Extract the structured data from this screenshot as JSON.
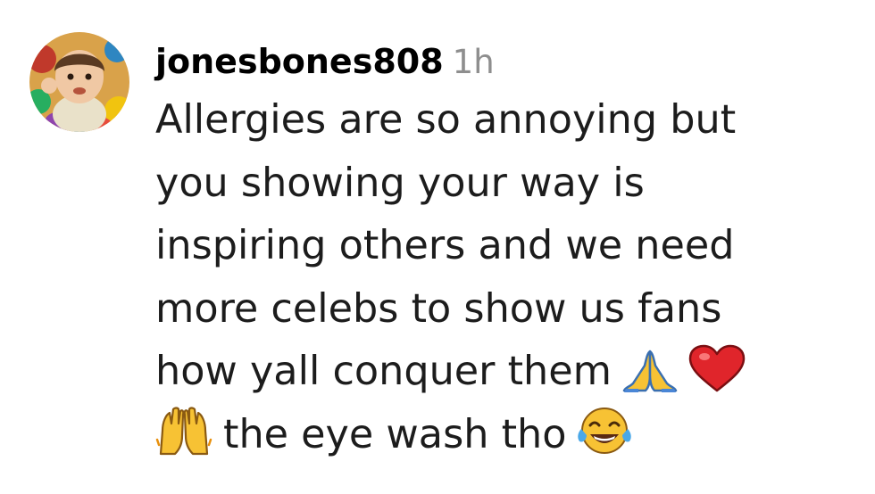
{
  "comment": {
    "username": "jonesbones808",
    "timestamp": "1h",
    "lines": [
      "Allergies are so annoying but",
      "you showing your way is",
      "inspiring others and we need",
      "more celebs to show us fans",
      "how yall conquer them",
      "the eye wash tho"
    ],
    "emojis": {
      "line5": [
        "folded-hands-icon",
        "red-heart-icon"
      ],
      "line6_lead": "raising-hands-icon",
      "line6_trail": "tears-of-joy-icon"
    }
  }
}
